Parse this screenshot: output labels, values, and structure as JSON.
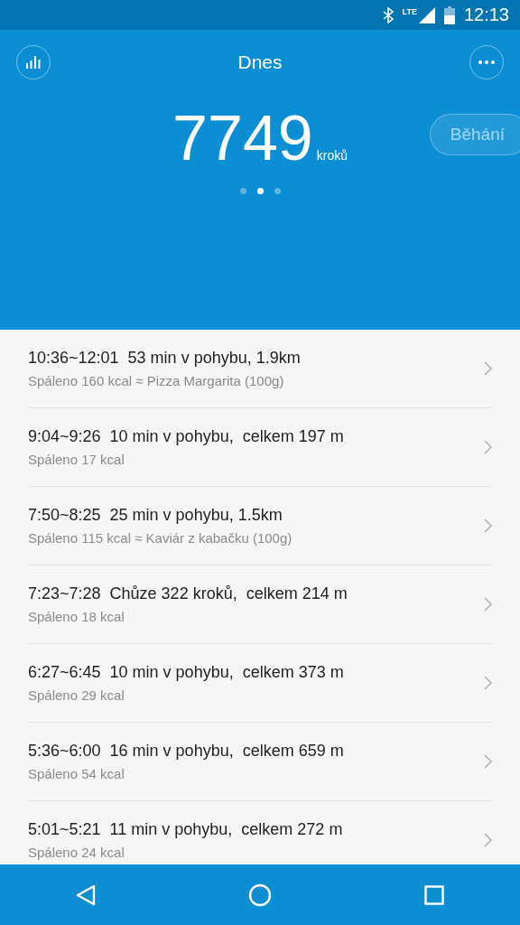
{
  "status_bar": {
    "network": "LTE",
    "time": "12:13"
  },
  "header": {
    "title": "Dnes",
    "steps": "7749",
    "steps_unit": "kroků",
    "mode_button": "Běhání",
    "pager": [
      {
        "selected": false
      },
      {
        "selected": true
      },
      {
        "selected": false
      }
    ]
  },
  "activities": [
    {
      "title": "10:36~12:01  53 min v pohybu, 1.9km",
      "subtitle": "Spáleno 160 kcal ≈ Pizza Margarita (100g)"
    },
    {
      "title": "9:04~9:26  10 min v pohybu,  celkem 197 m",
      "subtitle": "Spáleno 17 kcal"
    },
    {
      "title": "7:50~8:25  25 min v pohybu, 1.5km",
      "subtitle": "Spáleno 115 kcal ≈ Kaviár z kabačku (100g)"
    },
    {
      "title": "7:23~7:28  Chůze 322 kroků,  celkem 214 m",
      "subtitle": "Spáleno 18 kcal"
    },
    {
      "title": "6:27~6:45  10 min v pohybu,  celkem 373 m",
      "subtitle": "Spáleno 29 kcal"
    },
    {
      "title": "5:36~6:00  16 min v pohybu,  celkem 659 m",
      "subtitle": "Spáleno 54 kcal"
    },
    {
      "title": "5:01~5:21  11 min v pohybu,  celkem 272 m",
      "subtitle": "Spáleno 24 kcal"
    }
  ]
}
